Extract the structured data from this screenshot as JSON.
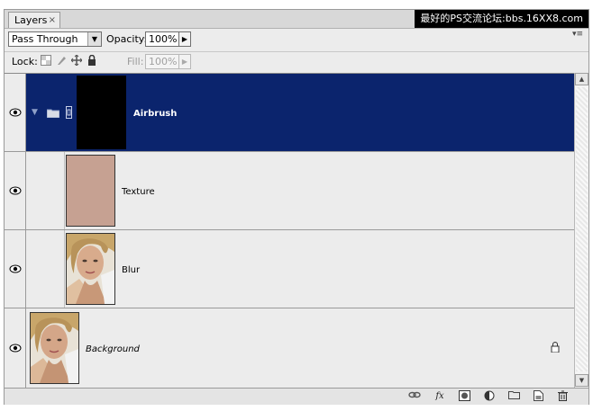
{
  "panel": {
    "tab_label": "Layers",
    "tab_close": "×",
    "watermark": "最好的PS交流论坛:bbs.16XX8.com",
    "menu_glyph": "▾≡"
  },
  "options": {
    "blend_mode": "Pass Through",
    "opacity_label": "Opacity:",
    "opacity_value": "100%",
    "lock_label": "Lock:",
    "fill_label": "Fill:",
    "fill_value": "100%"
  },
  "layers": [
    {
      "name": "Airbrush",
      "type": "group",
      "selected": true,
      "visible": true
    },
    {
      "name": "Texture",
      "type": "layer",
      "selected": false,
      "visible": true,
      "thumb_color": "#c6a192"
    },
    {
      "name": "Blur",
      "type": "layer",
      "selected": false,
      "visible": true
    },
    {
      "name": "Background",
      "type": "background",
      "selected": false,
      "visible": true,
      "locked": true
    }
  ],
  "colors": {
    "selection": "#0b246d",
    "panel_bg": "#ececec"
  },
  "bottom_icons": [
    "link-icon",
    "fx-icon",
    "mask-icon",
    "adjustment-icon",
    "folder-icon",
    "new-layer-icon",
    "trash-icon"
  ]
}
